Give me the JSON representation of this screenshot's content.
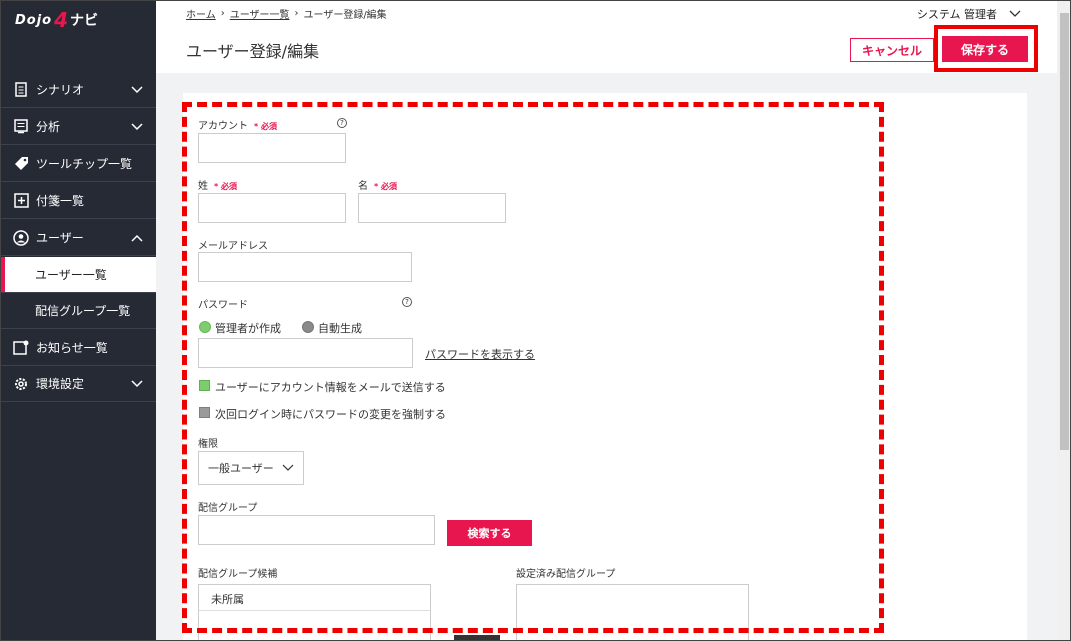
{
  "app": {
    "logo_dojo": "Dojo",
    "logo_four": "4",
    "logo_navi": "ナビ"
  },
  "sidebar": {
    "items": [
      {
        "label": "シナリオ",
        "icon": "document-icon",
        "expandable": true
      },
      {
        "label": "分析",
        "icon": "list-icon",
        "expandable": true
      },
      {
        "label": "ツールチップ一覧",
        "icon": "tag-icon"
      },
      {
        "label": "付箋一覧",
        "icon": "sticky-note-icon"
      },
      {
        "label": "ユーザー",
        "icon": "user-icon",
        "expanded": true
      },
      {
        "label": "ユーザー一覧",
        "sub": true,
        "active": true
      },
      {
        "label": "配信グループ一覧",
        "sub": true
      },
      {
        "label": "お知らせ一覧",
        "icon": "notice-icon"
      },
      {
        "label": "環境設定",
        "icon": "gear-icon",
        "expandable": true
      }
    ]
  },
  "header": {
    "breadcrumb": [
      "ホーム",
      "ユーザー一覧",
      "ユーザー登録/編集"
    ],
    "title": "ユーザー登録/編集",
    "user_menu": "システム 管理者",
    "cancel_label": "キャンセル",
    "save_label": "保存する"
  },
  "form": {
    "account_label": "アカウント",
    "required": "* 必須",
    "last_name_label": "姓",
    "first_name_label": "名",
    "email_label": "メールアドレス",
    "password_label": "パスワード",
    "radio_admin": "管理者が作成",
    "radio_auto": "自動生成",
    "show_password": "パスワードを表示する",
    "send_mail": "ユーザーにアカウント情報をメールで送信する",
    "force_change": "次回ログイン時にパスワードの変更を強制する",
    "role_label": "権限",
    "role_value": "一般ユーザー",
    "group_label": "配信グループ",
    "search_label": "検索する",
    "candidates_label": "配信グループ候補",
    "assigned_label": "設定済み配信グループ",
    "candidates": [
      "未所属"
    ]
  },
  "colors": {
    "accent": "#e8164f",
    "sidebar": "#262a35",
    "radio_on": "#7dcc6e",
    "radio_off": "#888888"
  }
}
